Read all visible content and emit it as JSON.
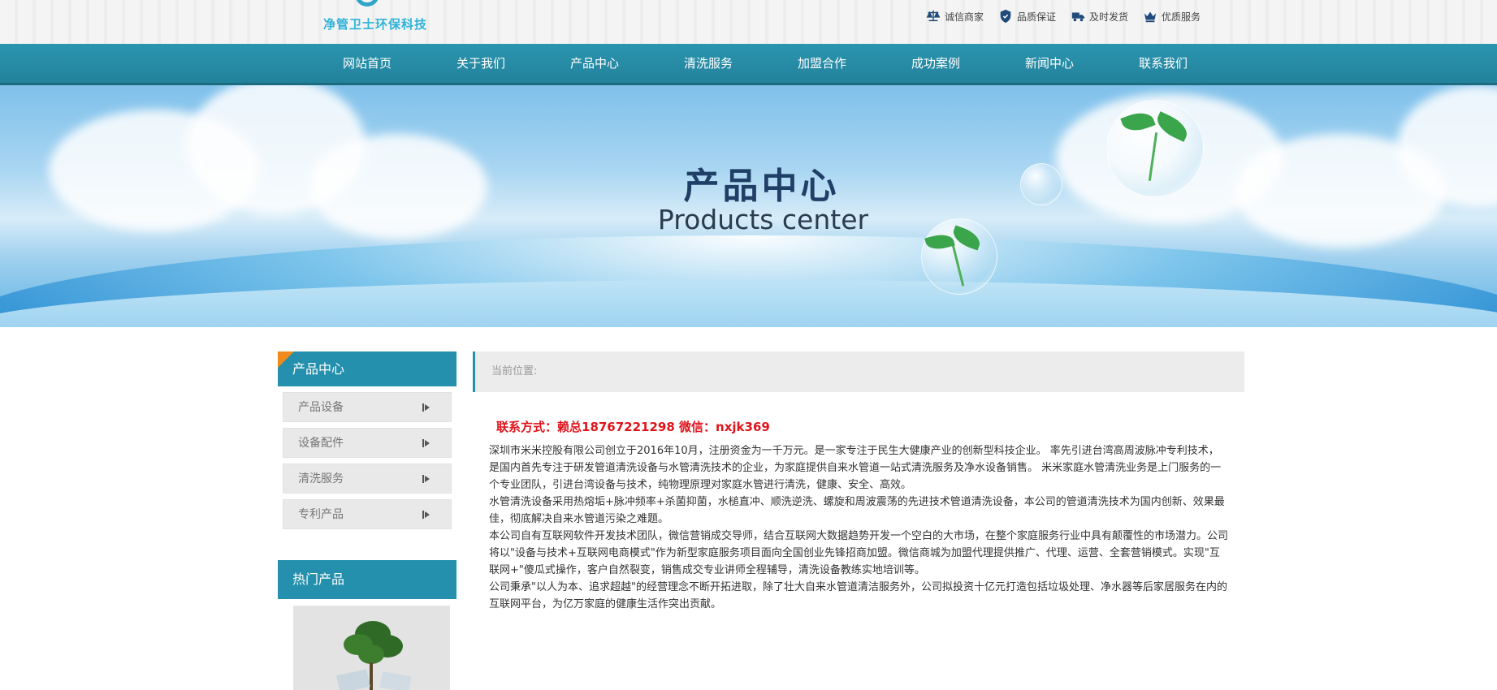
{
  "header": {
    "logo_text": "净管卫士环保科技",
    "badges": [
      {
        "icon": "scale-icon",
        "label": "诚信商家"
      },
      {
        "icon": "shield-icon",
        "label": "品质保证"
      },
      {
        "icon": "delivery-icon",
        "label": "及时发货"
      },
      {
        "icon": "crown-icon",
        "label": "优质服务"
      }
    ]
  },
  "nav": {
    "items": [
      "网站首页",
      "关于我们",
      "产品中心",
      "清洗服务",
      "加盟合作",
      "成功案例",
      "新闻中心",
      "联系我们"
    ]
  },
  "banner": {
    "title": "产品中心",
    "subtitle": "Products center"
  },
  "sidebar": {
    "title": "产品中心",
    "items": [
      "产品设备",
      "设备配件",
      "清洗服务",
      "专利产品"
    ],
    "hot_title": "热门产品"
  },
  "main": {
    "breadcrumb": "当前位置:",
    "contact": "联系方式：赖总18767221298 微信：nxjk369",
    "paragraphs": [
      "深圳市米米控股有限公司创立于2016年10月，注册资金为一千万元。是一家专注于民生大健康产业的创新型科技企业。 率先引进台湾高周波脉冲专利技术，是国内首先专注于研发管道清洗设备与水管清洗技术的企业，为家庭提供自来水管道一站式清洗服务及净水设备销售。 米米家庭水管清洗业务是上门服务的一个专业团队，引进台湾设备与技术，纯物理原理对家庭水管进行清洗，健康、安全、高效。",
      "水管清洗设备采用热熔垢+脉冲频率+杀菌抑菌，水槌直冲、顺洗逆洗、螺旋和周波震荡的先进技术管道清洗设备，本公司的管道清洗技术为国内创新、效果最佳，彻底解决自来水管道污染之难题。",
      "本公司自有互联网软件开发技术团队，微信营销成交导师，结合互联网大数据趋势开发一个空白的大市场，在整个家庭服务行业中具有颠覆性的市场潜力。公司将以\"设备与技术+互联网电商模式\"作为新型家庭服务项目面向全国创业先锋招商加盟。微信商城为加盟代理提供推广、代理、运营、全套营销模式。实现\"互联网+\"傻瓜式操作，客户自然裂变，销售成交专业讲师全程辅导，清洗设备教练实地培训等。",
      "公司秉承\"以人为本、追求超越\"的经营理念不断开拓进取，除了壮大自来水管道清洁服务外，公司拟投资十亿元打造包括垃圾处理、净水器等后家居服务在内的互联网平台，为亿万家庭的健康生活作突出贡献。"
    ]
  }
}
